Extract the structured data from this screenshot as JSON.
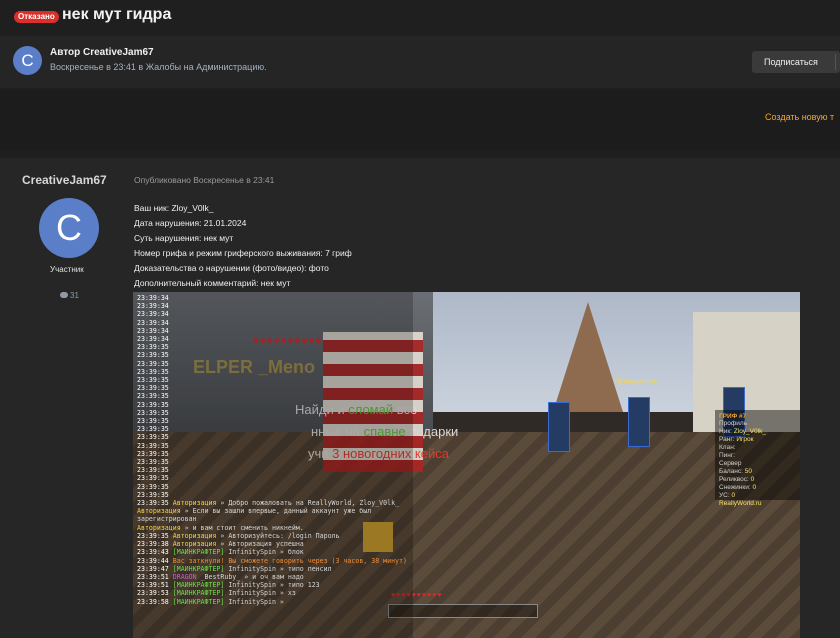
{
  "header": {
    "badge": "Отказано",
    "title": "нек мут гидра"
  },
  "author_block": {
    "avatar_letter": "C",
    "author_line": "Автор CreativeJam67",
    "meta": "Воскресенье в 23:41 в Жалобы на Администрацию.",
    "subscribe_label": "Подписаться"
  },
  "create_link": "Создать новую т",
  "post": {
    "author": "CreativeJam67",
    "avatar_letter": "C",
    "role": "Участник",
    "posts_count": "31",
    "published": "Опубликовано Воскресенье в 23:41",
    "lines": [
      "Ваш ник: Zloy_V0lk_",
      "Дата нарушения: 21.01.2024",
      "Суть нарушения: нек мут",
      "Номер грифа и режим гриферского выживания: 7 гриф",
      "Доказательства о нарушении (фото/видео): фото",
      "Дополнительный комментарий: нек мут"
    ]
  },
  "screenshot": {
    "helper": "ELPER _Meno",
    "overlay1_a": "Найди и ",
    "overlay1_b": "сломай",
    "overlay1_c": " все",
    "overlay2_a": "нные на ",
    "overlay2_b": "спавне",
    "overlay2_c": " подарки",
    "overlay3_a": "учи ",
    "overlay3_b": "3 новогодних кейса",
    "npc_label_1": "Путеводитель",
    "scoreboard_title": "ГРИФ #7",
    "scoreboard": [
      {
        "k": "Профиль",
        "v": ""
      },
      {
        "k": "Ник: ",
        "v": "Zloy_V0lk_"
      },
      {
        "k": "Ранг: ",
        "v": "Игрок"
      },
      {
        "k": "Клан: ",
        "v": ""
      },
      {
        "k": "Пинг: ",
        "v": ""
      },
      {
        "k": "Сервер",
        "v": ""
      },
      {
        "k": "Баланс: ",
        "v": "50"
      },
      {
        "k": "Реликвос: ",
        "v": "0"
      },
      {
        "k": "Снежинки: ",
        "v": "0"
      },
      {
        "k": "УС: ",
        "v": "0"
      },
      {
        "k": "",
        "v": "ReallyWorld.ru"
      }
    ],
    "chat": [
      {
        "time": "23:39:34",
        "msg": ""
      },
      {
        "time": "23:39:34",
        "msg": ""
      },
      {
        "time": "23:39:34",
        "msg": ""
      },
      {
        "time": "23:39:34",
        "msg": ""
      },
      {
        "time": "23:39:34",
        "msg": ""
      },
      {
        "time": "23:39:34",
        "msg": ""
      },
      {
        "time": "23:39:35",
        "msg": ""
      },
      {
        "time": "23:39:35",
        "msg": ""
      },
      {
        "time": "23:39:35",
        "msg": ""
      },
      {
        "time": "23:39:35",
        "msg": ""
      },
      {
        "time": "23:39:35",
        "msg": ""
      },
      {
        "time": "23:39:35",
        "msg": ""
      },
      {
        "time": "23:39:35",
        "msg": ""
      },
      {
        "time": "23:39:35",
        "msg": ""
      },
      {
        "time": "23:39:35",
        "msg": ""
      },
      {
        "time": "23:39:35",
        "msg": ""
      },
      {
        "time": "23:39:35",
        "msg": ""
      },
      {
        "time": "23:39:35",
        "msg": ""
      },
      {
        "time": "23:39:35",
        "msg": ""
      },
      {
        "time": "23:39:35",
        "msg": ""
      },
      {
        "time": "23:39:35",
        "msg": ""
      },
      {
        "time": "23:39:35",
        "msg": ""
      },
      {
        "time": "23:39:35",
        "msg": ""
      },
      {
        "time": "23:39:35",
        "msg": ""
      },
      {
        "time": "23:39:35",
        "msg": ""
      },
      {
        "time": "23:39:35",
        "tag": "Авторизация",
        "msg": " » Добро пожаловать на ReallyWorld, Zloy_V0lk_"
      },
      {
        "time": "",
        "tag": "Авторизация",
        "msg": " » Если вы зашли впервые, данный аккаунт уже был"
      },
      {
        "time": "",
        "msg": "зарегистрирован"
      },
      {
        "time": "",
        "tag": "Авторизация",
        "msg": " » и вам стоит сменить никнейм."
      },
      {
        "time": "23:39:35",
        "tag": "Авторизация",
        "msg": " » Авторизуйтесь: /login Пароль"
      },
      {
        "time": "23:39:38",
        "tag": "Авторизация",
        "msg": " » Авторизация успешна"
      },
      {
        "time": "23:39:43",
        "g": "[МАЙНКРАФТЕР]",
        "msg": " InfinitySpin » блок"
      },
      {
        "time": "23:39:44",
        "o": "Вас заткнули! Вы сможете говорить через (3 часов, 38 минут)",
        "msg": ""
      },
      {
        "time": "23:39:47",
        "g": "[МАЙНКРАФТЕР]",
        "msg": " InfinitySpin » типо пенсил"
      },
      {
        "time": "23:39:51",
        "p": "DRAGON",
        "msg": " _BestRuby_ » и оч вам надо"
      },
      {
        "time": "23:39:51",
        "g": "[МАЙНКРАФТЕР]",
        "msg": " InfinitySpin » типо 123"
      },
      {
        "time": "23:39:53",
        "g": "[МАЙНКРАФТЕР]",
        "msg": " InfinitySpin » хз"
      },
      {
        "time": "23:39:58",
        "g": "[МАЙНКРАФТЕР]",
        "msg": " InfinitySpin » "
      }
    ]
  }
}
